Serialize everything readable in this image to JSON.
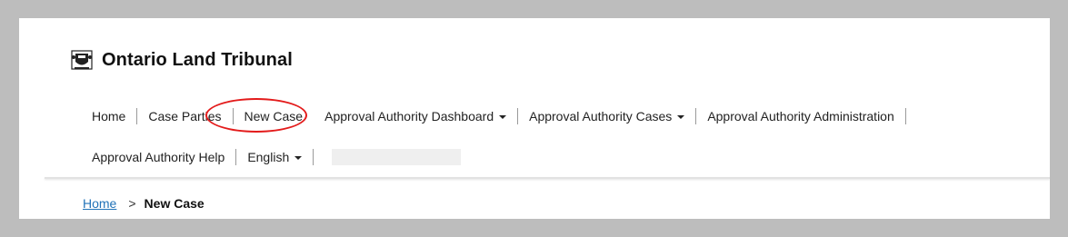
{
  "brand": {
    "title": "Ontario Land Tribunal"
  },
  "nav": {
    "row1": [
      {
        "label": "Home"
      },
      {
        "label": "Case Parties"
      },
      {
        "label": "New Case"
      },
      {
        "label": "Approval Authority Dashboard"
      },
      {
        "label": "Approval Authority Cases"
      },
      {
        "label": "Approval Authority Administration"
      }
    ],
    "row2": [
      {
        "label": "Approval Authority Help"
      },
      {
        "label": "English"
      }
    ]
  },
  "breadcrumb": {
    "home": "Home",
    "separator": ">",
    "current": "New Case"
  },
  "colors": {
    "highlight_ring": "#e31b1b",
    "link": "#2273b8",
    "outer_background": "#bdbdbd"
  },
  "icons": {
    "crest": "ontario-crest-icon",
    "dropdown": "caret-down-icon"
  }
}
